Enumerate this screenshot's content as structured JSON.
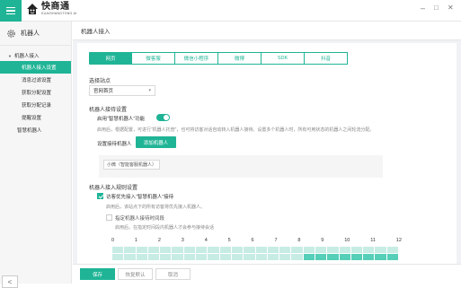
{
  "app": {
    "brand_cn": "快商通",
    "brand_en": "KUAISHANGTONG AI"
  },
  "window": {
    "minimize": "–",
    "maximize": "□",
    "close": "✕"
  },
  "sidebar": {
    "header": "机器人",
    "group": "机器人接入",
    "items": [
      {
        "label": "机器人接入设置",
        "active": true
      },
      {
        "label": "消息过滤设置",
        "active": false
      },
      {
        "label": "获取分配设置",
        "active": false
      },
      {
        "label": "获取分配记录",
        "active": false
      },
      {
        "label": "提醒设置",
        "active": false
      }
    ],
    "extra": "智慧机器人",
    "collapse": "<"
  },
  "main": {
    "title": "机器人接入",
    "tabs": [
      "网页",
      "微客服",
      "微信小程序",
      "微博",
      "SDK",
      "抖音"
    ],
    "active_tab": 0,
    "site_label": "选择站点",
    "site_value": "官网首页",
    "reception_title": "机器人接待设置",
    "enable_label": "启用“智慧机器人”功能",
    "enable_on": true,
    "enable_desc": "启用后，根据配置，可进行“机器人托管”，也可将访客对话自动转入机器人接待。设置多个机器人时，所有可用状态的机器人之间轮流分配。",
    "set_robot_label": "设置接待机器人",
    "add_robot_btn": "添加机器人",
    "robot_chip": "小微（智能客服机器人）",
    "rules_title": "机器人接入规则设置",
    "rule1_label": "访客优先接入“智慧机器人”接待",
    "rule1_checked": true,
    "rule1_desc": "启用后，该站点下的所有访客将优先接入机器人。",
    "rule2_label": "指定机器人接待时间段",
    "rule2_checked": false,
    "rule2_desc": "启用后，在指定时间段内机器人才会参与接待会话",
    "hours": [
      "0",
      "1",
      "2",
      "3",
      "4",
      "5",
      "6",
      "7",
      "8",
      "9",
      "10",
      "11",
      "12"
    ],
    "schedule_row1_on_from": 24,
    "schedule_row2_on_from": 16
  },
  "footer": {
    "save": "保存",
    "restore": "恢复默认",
    "cancel": "取消"
  },
  "colors": {
    "accent": "#1fb496"
  }
}
